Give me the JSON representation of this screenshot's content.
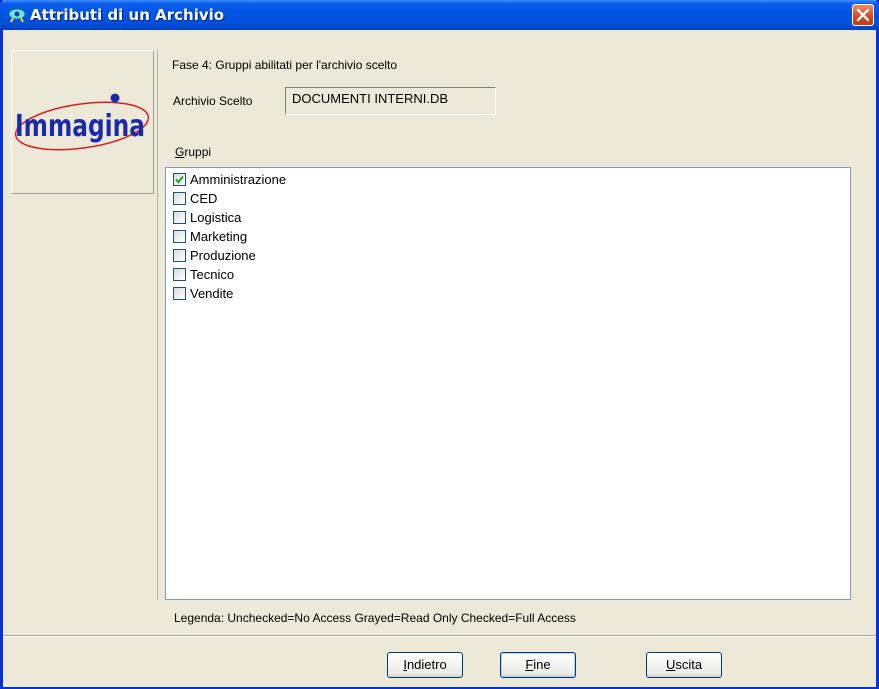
{
  "window": {
    "title": "Attributi di un Archivio"
  },
  "logo": {
    "text": "Immagina"
  },
  "step": {
    "title": "Fase 4: Gruppi abilitati per l'archivio scelto"
  },
  "archive": {
    "label": "Archivio Scelto",
    "value": "DOCUMENTI INTERNI.DB"
  },
  "groups": {
    "label": "Gruppi",
    "items": [
      {
        "label": "Amministrazione",
        "checked": true
      },
      {
        "label": "CED",
        "checked": false
      },
      {
        "label": "Logistica",
        "checked": false
      },
      {
        "label": "Marketing",
        "checked": false
      },
      {
        "label": "Produzione",
        "checked": false
      },
      {
        "label": "Tecnico",
        "checked": false
      },
      {
        "label": "Vendite",
        "checked": false
      }
    ]
  },
  "legend": "Legenda: Unchecked=No Access Grayed=Read Only Checked=Full Access",
  "buttons": {
    "back": {
      "mnemonic": "I",
      "rest": "ndietro"
    },
    "finish": {
      "mnemonic": "F",
      "rest": "ine"
    },
    "exit": {
      "mnemonic": "U",
      "rest": "scita"
    }
  },
  "colors": {
    "titlebar": "#0054E3",
    "window_bg": "#ECE9D8",
    "logo_text": "#1A2AA8",
    "logo_ellipse": "#D82020"
  }
}
